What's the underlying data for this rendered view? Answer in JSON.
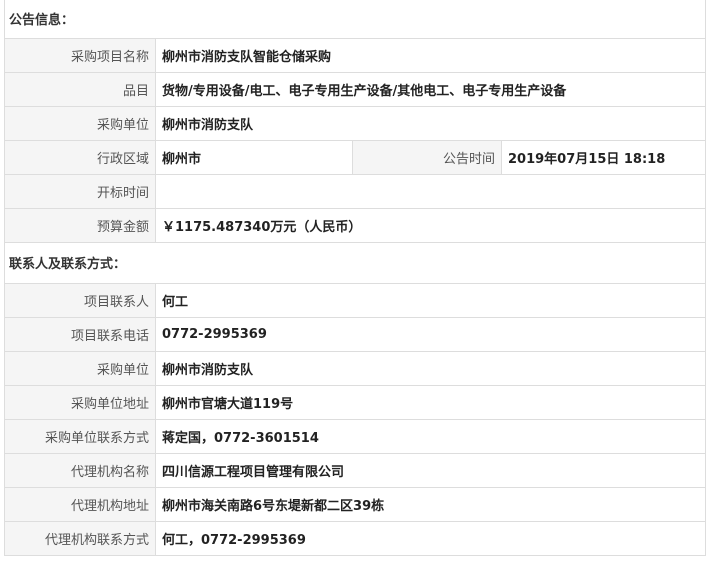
{
  "notice": {
    "header": "公告信息：",
    "rows": [
      {
        "label": "采购项目名称",
        "value": "柳州市消防支队智能仓储采购"
      },
      {
        "label": "品目",
        "value": "货物/专用设备/电工、电子专用生产设备/其他电工、电子专用生产设备"
      },
      {
        "label": "采购单位",
        "value": "柳州市消防支队"
      }
    ],
    "region": {
      "label": "行政区域",
      "value": "柳州市"
    },
    "time": {
      "label": "公告时间",
      "value": "2019年07月15日 18:18"
    },
    "rows2": [
      {
        "label": "开标时间",
        "value": ""
      },
      {
        "label": "预算金额",
        "value": "￥1175.487340万元（人民币）"
      }
    ]
  },
  "contact": {
    "header": "联系人及联系方式：",
    "rows": [
      {
        "label": "项目联系人",
        "value": "何工"
      },
      {
        "label": "项目联系电话",
        "value": "0772-2995369"
      },
      {
        "label": "采购单位",
        "value": "柳州市消防支队"
      },
      {
        "label": "采购单位地址",
        "value": "柳州市官塘大道119号"
      },
      {
        "label": "采购单位联系方式",
        "value": "蒋定国，0772-3601514"
      },
      {
        "label": "代理机构名称",
        "value": "四川信源工程项目管理有限公司"
      },
      {
        "label": "代理机构地址",
        "value": "柳州市海关南路6号东堤新都二区39栋"
      },
      {
        "label": "代理机构联系方式",
        "value": "何工，0772-2995369"
      }
    ]
  }
}
